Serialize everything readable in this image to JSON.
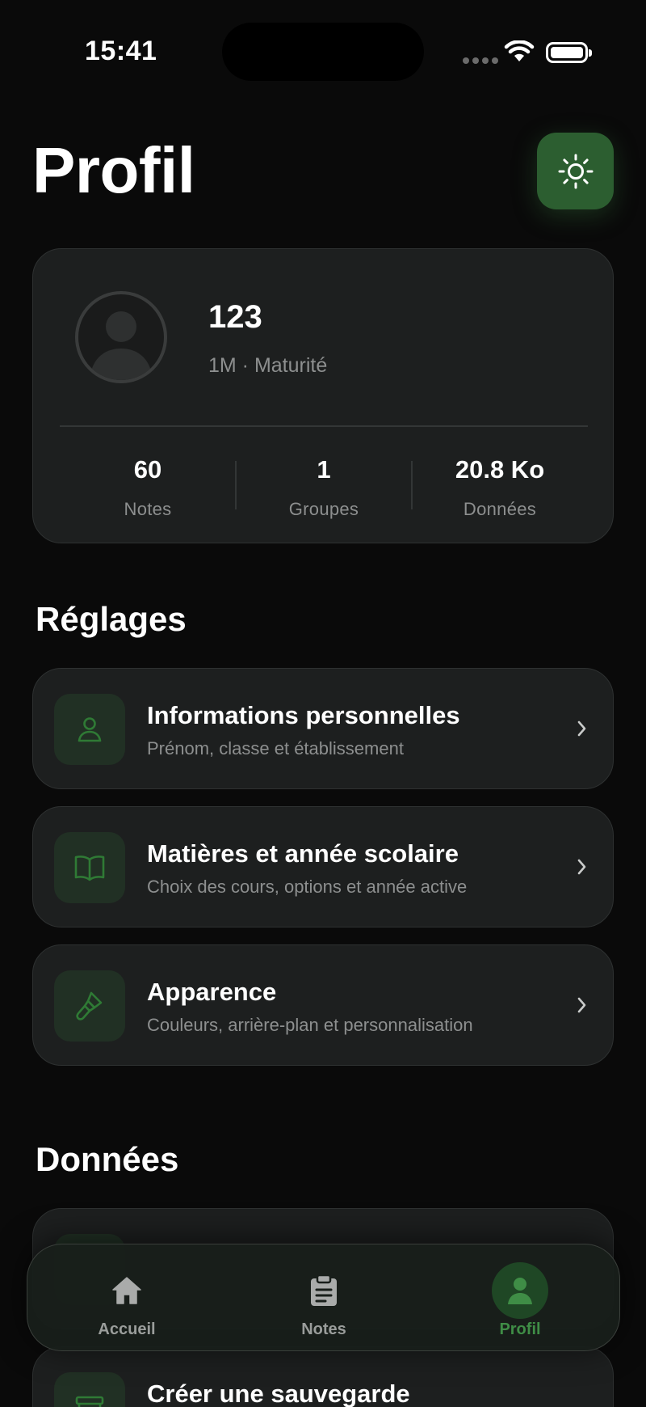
{
  "status_bar": {
    "time": "15:41"
  },
  "header": {
    "title": "Profil"
  },
  "profile": {
    "name": "123",
    "meta": "1M · Maturité",
    "stats": [
      {
        "value": "60",
        "label": "Notes"
      },
      {
        "value": "1",
        "label": "Groupes"
      },
      {
        "value": "20.8 Ko",
        "label": "Données"
      }
    ]
  },
  "settings": {
    "title": "Réglages",
    "items": [
      {
        "title": "Informations personnelles",
        "subtitle": "Prénom, classe et établissement",
        "icon": "person-icon"
      },
      {
        "title": "Matières et année scolaire",
        "subtitle": "Choix des cours, options et année active",
        "icon": "book-icon"
      },
      {
        "title": "Apparence",
        "subtitle": "Couleurs, arrière-plan et personnalisation",
        "icon": "paintbrush-icon"
      }
    ]
  },
  "data_section": {
    "title": "Données",
    "items": [
      {
        "title": "Créer une sauvegarde",
        "icon": "archive-icon"
      }
    ]
  },
  "tabbar": {
    "tabs": [
      {
        "label": "Accueil",
        "icon": "home-icon"
      },
      {
        "label": "Notes",
        "icon": "clipboard-icon"
      },
      {
        "label": "Profil",
        "icon": "person-icon",
        "active": true
      }
    ]
  },
  "colors": {
    "accent": "#2c5e30",
    "accent_text": "#3f8d46",
    "background": "#0a0a0a",
    "card": "#1d1f1f"
  }
}
